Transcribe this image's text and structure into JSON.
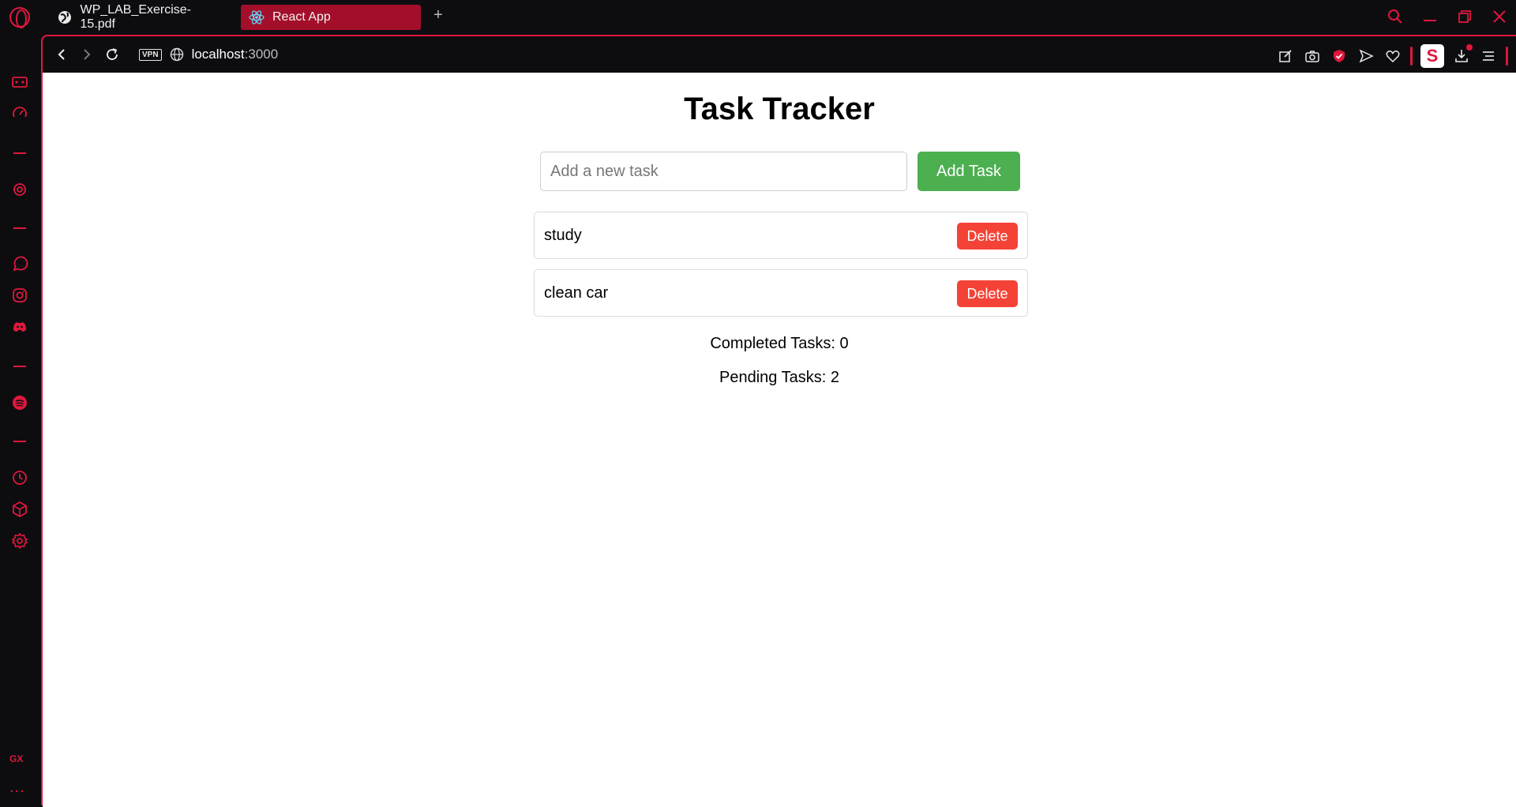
{
  "browser": {
    "tabs": [
      {
        "label": "WP_LAB_Exercise-15.pdf",
        "icon": "globe-icon",
        "active": false
      },
      {
        "label": "React App",
        "icon": "react-icon",
        "active": true
      }
    ],
    "url_host": "localhost",
    "url_port": ":3000",
    "vpn_label": "VPN",
    "ext_label": "S",
    "sidebar_gx": "GX",
    "sidebar_more": "...",
    "new_tab_label": "+",
    "accent_color": "#e0173d"
  },
  "app": {
    "title": "Task Tracker",
    "input": {
      "placeholder": "Add a new task",
      "value": ""
    },
    "add_button": "Add Task",
    "tasks": [
      {
        "text": "study",
        "delete_label": "Delete"
      },
      {
        "text": "clean car",
        "delete_label": "Delete"
      }
    ],
    "completed_text": "Completed Tasks: 0",
    "pending_text": "Pending Tasks: 2",
    "colors": {
      "add": "#4caf50",
      "delete": "#f44336"
    }
  }
}
